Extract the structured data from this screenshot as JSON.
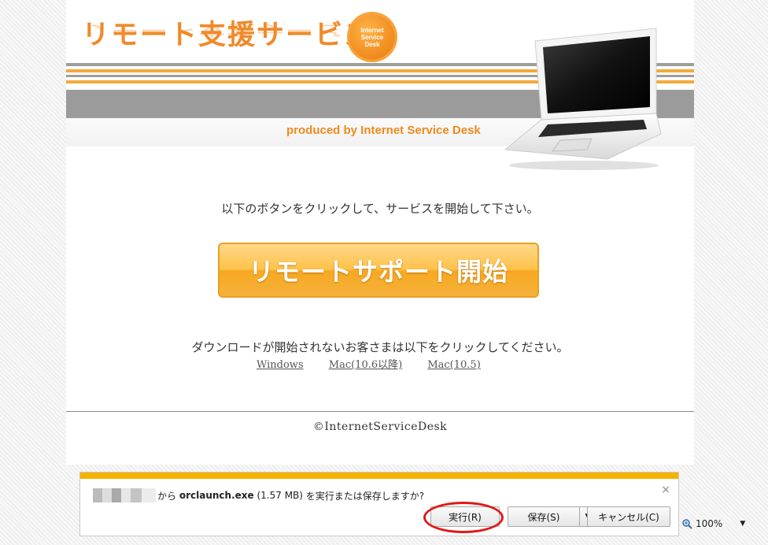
{
  "header": {
    "logo_text": "リモート支援サービス",
    "seal_lines": [
      "Internet",
      "Service",
      "Desk"
    ],
    "tagline": "produced by Internet Service Desk"
  },
  "main": {
    "instruction": "以下のボタンをクリックして、サービスを開始して下さい。",
    "start_button": "リモートサポート開始",
    "download_note": "ダウンロードが開始されないお客さまは以下をクリックしてください。",
    "download_links": [
      "Windows",
      "Mac(10.6以降)",
      "Mac(10.5)"
    ]
  },
  "footer": {
    "copyright": "©InternetServiceDesk"
  },
  "notification": {
    "prefix": "から",
    "filename": "orclaunch.exe",
    "size": "(1.57 MB)",
    "question": "を実行または保存しますか?",
    "run_label": "実行(R)",
    "save_label": "保存(S)",
    "cancel_label": "キャンセル(C)",
    "close_glyph": "×",
    "dropdown_glyph": "▼"
  },
  "statusbar": {
    "zoom": "100%",
    "zoom_icon": "magnifier-icon",
    "zoom_arrow": "▼"
  },
  "colors": {
    "accent_orange": "#f08a2a",
    "button_orange": "#ffc24b",
    "notification_bar": "#f5b300",
    "highlight_ring": "#e01818"
  }
}
